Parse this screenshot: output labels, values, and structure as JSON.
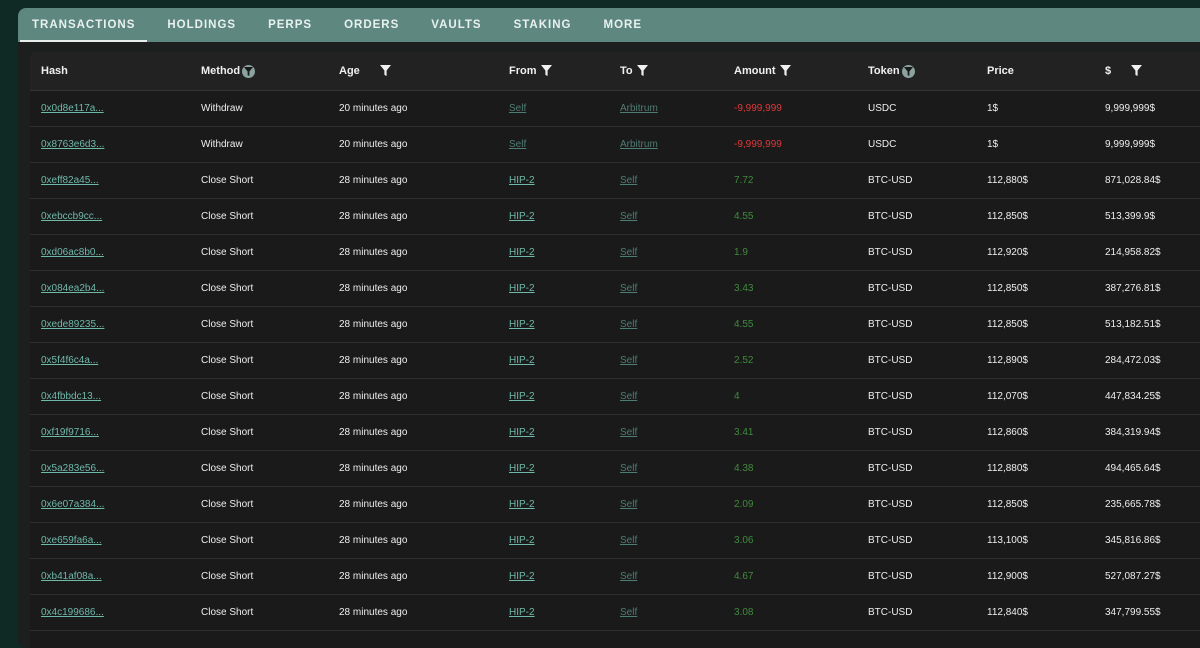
{
  "tabs": [
    {
      "label": "TRANSACTIONS",
      "active": true
    },
    {
      "label": "HOLDINGS"
    },
    {
      "label": "PERPS"
    },
    {
      "label": "ORDERS"
    },
    {
      "label": "VAULTS"
    },
    {
      "label": "STAKING"
    },
    {
      "label": "MORE"
    }
  ],
  "columns": {
    "hash": "Hash",
    "method": "Method",
    "age": "Age",
    "from": "From",
    "to": "To",
    "amount": "Amount",
    "token": "Token",
    "price": "Price",
    "usd": "$"
  },
  "colors": {
    "tabbar": "#5e877f",
    "background": "#0f2a24",
    "card": "#1a1a1a",
    "link": "#6fb9a9",
    "negative": "#e0383b",
    "positive": "#3f8a3c"
  },
  "rows": [
    {
      "hash": "0x0d8e117a...",
      "method": "Withdraw",
      "age": "20 minutes ago",
      "from": "Self",
      "to": "Arbitrum",
      "amount": "-9,999,999",
      "amount_sign": "neg",
      "token": "USDC",
      "price": "1$",
      "usd": "9,999,999$"
    },
    {
      "hash": "0x8763e6d3...",
      "method": "Withdraw",
      "age": "20 minutes ago",
      "from": "Self",
      "to": "Arbitrum",
      "amount": "-9,999,999",
      "amount_sign": "neg",
      "token": "USDC",
      "price": "1$",
      "usd": "9,999,999$"
    },
    {
      "hash": "0xeff82a45...",
      "method": "Close Short",
      "age": "28 minutes ago",
      "from": "HIP-2",
      "to": "Self",
      "amount": "7.72",
      "amount_sign": "pos",
      "token": "BTC-USD",
      "price": "112,880$",
      "usd": "871,028.84$"
    },
    {
      "hash": "0xebccb9cc...",
      "method": "Close Short",
      "age": "28 minutes ago",
      "from": "HIP-2",
      "to": "Self",
      "amount": "4.55",
      "amount_sign": "pos",
      "token": "BTC-USD",
      "price": "112,850$",
      "usd": "513,399.9$"
    },
    {
      "hash": "0xd06ac8b0...",
      "method": "Close Short",
      "age": "28 minutes ago",
      "from": "HIP-2",
      "to": "Self",
      "amount": "1.9",
      "amount_sign": "pos",
      "token": "BTC-USD",
      "price": "112,920$",
      "usd": "214,958.82$"
    },
    {
      "hash": "0x084ea2b4...",
      "method": "Close Short",
      "age": "28 minutes ago",
      "from": "HIP-2",
      "to": "Self",
      "amount": "3.43",
      "amount_sign": "pos",
      "token": "BTC-USD",
      "price": "112,850$",
      "usd": "387,276.81$"
    },
    {
      "hash": "0xede89235...",
      "method": "Close Short",
      "age": "28 minutes ago",
      "from": "HIP-2",
      "to": "Self",
      "amount": "4.55",
      "amount_sign": "pos",
      "token": "BTC-USD",
      "price": "112,850$",
      "usd": "513,182.51$"
    },
    {
      "hash": "0x5f4f6c4a...",
      "method": "Close Short",
      "age": "28 minutes ago",
      "from": "HIP-2",
      "to": "Self",
      "amount": "2.52",
      "amount_sign": "pos",
      "token": "BTC-USD",
      "price": "112,890$",
      "usd": "284,472.03$"
    },
    {
      "hash": "0x4fbbdc13...",
      "method": "Close Short",
      "age": "28 minutes ago",
      "from": "HIP-2",
      "to": "Self",
      "amount": "4",
      "amount_sign": "pos",
      "token": "BTC-USD",
      "price": "112,070$",
      "usd": "447,834.25$"
    },
    {
      "hash": "0xf19f9716...",
      "method": "Close Short",
      "age": "28 minutes ago",
      "from": "HIP-2",
      "to": "Self",
      "amount": "3.41",
      "amount_sign": "pos",
      "token": "BTC-USD",
      "price": "112,860$",
      "usd": "384,319.94$"
    },
    {
      "hash": "0x5a283e56...",
      "method": "Close Short",
      "age": "28 minutes ago",
      "from": "HIP-2",
      "to": "Self",
      "amount": "4.38",
      "amount_sign": "pos",
      "token": "BTC-USD",
      "price": "112,880$",
      "usd": "494,465.64$"
    },
    {
      "hash": "0x6e07a384...",
      "method": "Close Short",
      "age": "28 minutes ago",
      "from": "HIP-2",
      "to": "Self",
      "amount": "2.09",
      "amount_sign": "pos",
      "token": "BTC-USD",
      "price": "112,850$",
      "usd": "235,665.78$"
    },
    {
      "hash": "0xe659fa6a...",
      "method": "Close Short",
      "age": "28 minutes ago",
      "from": "HIP-2",
      "to": "Self",
      "amount": "3.06",
      "amount_sign": "pos",
      "token": "BTC-USD",
      "price": "113,100$",
      "usd": "345,816.86$"
    },
    {
      "hash": "0xb41af08a...",
      "method": "Close Short",
      "age": "28 minutes ago",
      "from": "HIP-2",
      "to": "Self",
      "amount": "4.67",
      "amount_sign": "pos",
      "token": "BTC-USD",
      "price": "112,900$",
      "usd": "527,087.27$"
    },
    {
      "hash": "0x4c199686...",
      "method": "Close Short",
      "age": "28 minutes ago",
      "from": "HIP-2",
      "to": "Self",
      "amount": "3.08",
      "amount_sign": "pos",
      "token": "BTC-USD",
      "price": "112,840$",
      "usd": "347,799.55$"
    }
  ]
}
